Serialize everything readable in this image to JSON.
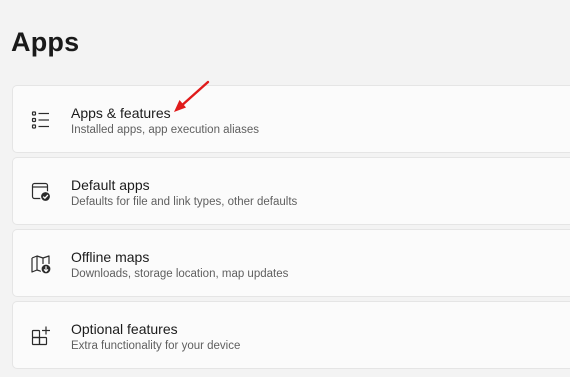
{
  "page": {
    "title": "Apps"
  },
  "items": [
    {
      "title": "Apps & features",
      "subtitle": "Installed apps, app execution aliases",
      "icon": "list-icon"
    },
    {
      "title": "Default apps",
      "subtitle": "Defaults for file and link types, other defaults",
      "icon": "default-apps-icon"
    },
    {
      "title": "Offline maps",
      "subtitle": "Downloads, storage location, map updates",
      "icon": "map-download-icon"
    },
    {
      "title": "Optional features",
      "subtitle": "Extra functionality for your device",
      "icon": "add-features-icon"
    }
  ],
  "colors": {
    "background": "#f3f3f3",
    "card": "#fbfbfb",
    "annotation_arrow": "#e01b1b"
  }
}
